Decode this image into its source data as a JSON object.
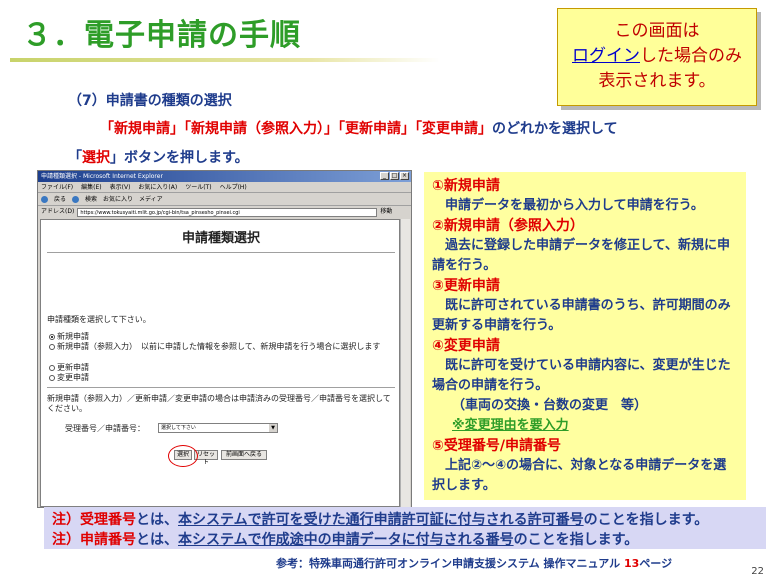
{
  "slide": {
    "title": "３．電子申請の手順",
    "page_number": "22"
  },
  "callout": {
    "line1": "この画面は",
    "line2_link": "ログイン",
    "line2_rest": "した場合のみ",
    "line3": "表示されます。"
  },
  "instructions": {
    "step": "（7）申請書の種類の選択",
    "opt1": "「新規申請」",
    "opt2": "「新規申請（参照入力）」",
    "opt3": "「更新申請」",
    "opt4": "「変更申請」",
    "tail1": "のどれかを選択して",
    "btn_open": "「",
    "btn_name": "選択",
    "btn_close": "」",
    "tail2": "ボタンを押します。"
  },
  "browser": {
    "window_title": "申請種類選択 - Microsoft Internet Explorer",
    "menu": [
      "ファイル(F)",
      "編集(E)",
      "表示(V)",
      "お気に入り(A)",
      "ツール(T)",
      "ヘルプ(H)"
    ],
    "toolbar": [
      "戻る",
      "検索",
      "お気に入り",
      "メディア"
    ],
    "address_label": "アドレス(D)",
    "address": "https://www.tokusyaiti.mlit.go.jp/cgi-bin/tsa_pinsesho_pinsei.cgi",
    "go_label": "移動",
    "page_title": "申請種類選択",
    "prompt": "申請種類を選択して下さい。",
    "radios": [
      {
        "label": "新規申請",
        "checked": true
      },
      {
        "label": "新規申請（参照入力）　以前に申請した情報を参照して、新規申請を行う場合に選択します",
        "checked": false
      },
      {
        "label": "更新申請",
        "checked": false
      },
      {
        "label": "変更申請",
        "checked": false
      }
    ],
    "note": "新規申請（参照入力）／更新申請／変更申請の場合は申請済みの受理番号／申請番号を選択してください。",
    "select_label": "受理番号／申請番号：",
    "select_value": "選択して下さい",
    "buttons": [
      "選択",
      "リセット",
      "前画面へ戻る"
    ]
  },
  "panel": {
    "items": [
      {
        "heading": "①新規申請",
        "lines": [
          "申請データを最初から入力して申請を行う。"
        ]
      },
      {
        "heading": "②新規申請（参照入力）",
        "lines": [
          "過去に登録した申請データを修正して、新規に申請を行う。"
        ]
      },
      {
        "heading": "③更新申請",
        "lines": [
          "既に許可されている申請書のうち、許可期間のみ更新する申請を行う。"
        ]
      },
      {
        "heading": "④変更申請",
        "lines": [
          "既に許可を受けている申請内容に、変更が生じた場合の申請を行う。"
        ],
        "extra": "（車両の交換・台数の変更　等）",
        "green": "※変更理由を要入力"
      },
      {
        "heading": "⑤受理番号/申請番号",
        "lines": [
          "上記②～④の場合に、対象となる申請データを選択します。"
        ]
      }
    ]
  },
  "notes": {
    "n1_term": "注）受理番号",
    "n1_mid": "とは、",
    "n1_def": "本システムで許可を受けた通行申請許可証に付与される許可番号",
    "n1_end": "のことを指します。",
    "n2_term": "注）申請番号",
    "n2_mid": "とは、",
    "n2_def": "本システムで作成途中の申請データに付与される番号",
    "n2_end": "のことを指します。"
  },
  "reference": {
    "text": "参考：特殊車両通行許可オンライン申請支援システム 操作マニュアル ",
    "page": "13",
    "suffix": "ページ"
  }
}
